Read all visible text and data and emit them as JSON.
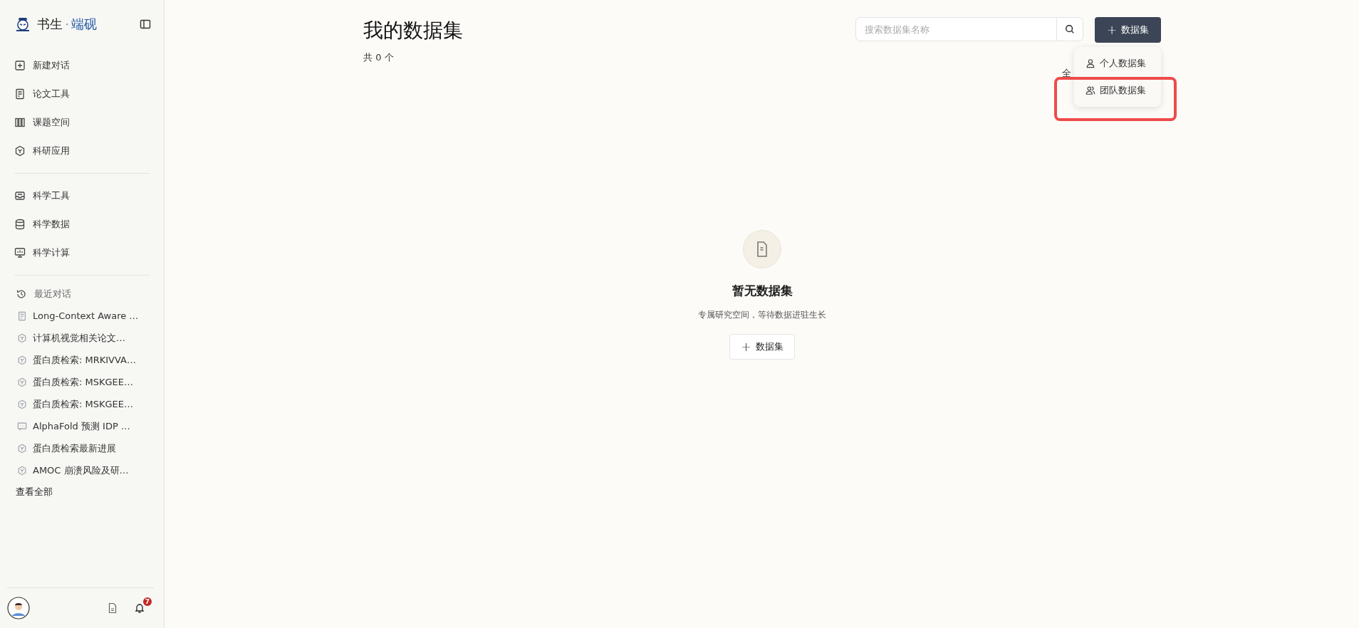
{
  "sidebar": {
    "logo": {
      "text_main": "书生",
      "separator": "·",
      "text_accent": "端砚"
    },
    "nav_groups": [
      [
        {
          "label": "新建对话",
          "kind": "new"
        },
        {
          "label": "论文工具",
          "kind": "paper"
        },
        {
          "label": "课题空间",
          "kind": "space"
        },
        {
          "label": "科研应用",
          "kind": "app"
        }
      ],
      [
        {
          "label": "科学工具",
          "kind": "tool"
        },
        {
          "label": "科学数据",
          "kind": "data"
        },
        {
          "label": "科学计算",
          "kind": "compute"
        }
      ]
    ],
    "recent": {
      "title": "最近对话",
      "items": [
        {
          "label": "Long-Context Aware …",
          "kind": "document"
        },
        {
          "label": "计算机视觉相关论文…",
          "kind": "app"
        },
        {
          "label": "蛋白质检索: MRKIVVA…",
          "kind": "app"
        },
        {
          "label": "蛋白质检索: MSKGEE…",
          "kind": "app"
        },
        {
          "label": "蛋白质检索: MSKGEE…",
          "kind": "app"
        },
        {
          "label": "AlphaFold 预测 IDP …",
          "kind": "chat"
        },
        {
          "label": "蛋白质检索最新进展",
          "kind": "app"
        },
        {
          "label": "AMOC 崩溃风险及研…",
          "kind": "app"
        }
      ],
      "view_all": "查看全部"
    },
    "notifications": {
      "count": "7"
    }
  },
  "main": {
    "title": "我的数据集",
    "count_text": "共 0 个",
    "filter_label": "全",
    "search": {
      "placeholder": "搜索数据集名称"
    },
    "add_button": {
      "icon": "+",
      "label": "数据集"
    },
    "dropdown": [
      {
        "label": "个人数据集",
        "kind": "person",
        "highlighted": false
      },
      {
        "label": "团队数据集",
        "kind": "team",
        "highlighted": true
      }
    ],
    "empty_state": {
      "title": "暂无数据集",
      "subtitle": "专属研究空间，等待数据进驻生长",
      "button": {
        "icon": "+",
        "label": "数据集"
      }
    }
  }
}
